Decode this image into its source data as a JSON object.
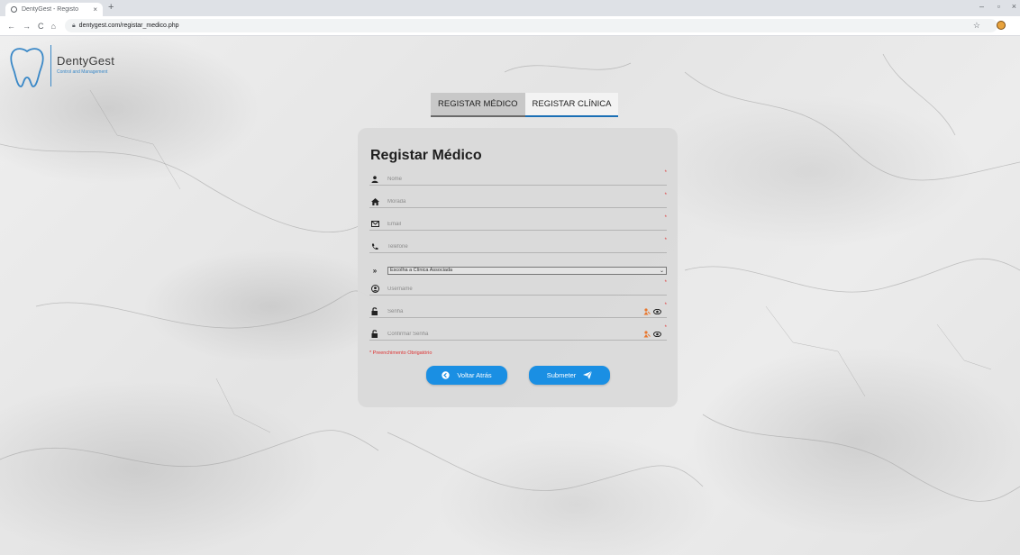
{
  "browser": {
    "tab_title": "DentyGest - Registo",
    "tab_close": "×",
    "new_tab": "+",
    "url": "dentygest.com/registar_medico.php",
    "back": "←",
    "forward": "→",
    "reload": "C",
    "home": "⌂",
    "minimize": "–",
    "restore": "▫",
    "close": "×"
  },
  "logo": {
    "name": "DentyGest",
    "tagline": "Control and Management"
  },
  "tabs": [
    {
      "label": "REGISTAR MÉDICO",
      "active": true
    },
    {
      "label": "REGISTAR CLÍNICA",
      "active": false
    }
  ],
  "form": {
    "title": "Registar Médico",
    "fields": {
      "nome": {
        "placeholder": "Nome",
        "icon": "user-icon"
      },
      "morada": {
        "placeholder": "Morada",
        "icon": "home-icon"
      },
      "email": {
        "placeholder": "Email",
        "icon": "envelope-icon"
      },
      "telefone": {
        "placeholder": "Telefone",
        "icon": "phone-icon"
      },
      "clinica": {
        "selected": "Escolha a Clínica Associada",
        "icon": "double-chevron-icon"
      },
      "username": {
        "placeholder": "Username",
        "icon": "user-circle-icon"
      },
      "senha": {
        "placeholder": "Senha",
        "icon": "unlock-icon"
      },
      "confirmar_senha": {
        "placeholder": "Confirmar Senha",
        "icon": "unlock-icon"
      }
    },
    "required_mark": "*",
    "mandatory_note": "* Preenchimento Obrigatório",
    "back_button": "Voltar Atrás",
    "submit_button": "Submeter"
  },
  "colors": {
    "accent": "#1a8fe3",
    "required": "#dd3333",
    "logo_blue": "#3a88c7"
  }
}
